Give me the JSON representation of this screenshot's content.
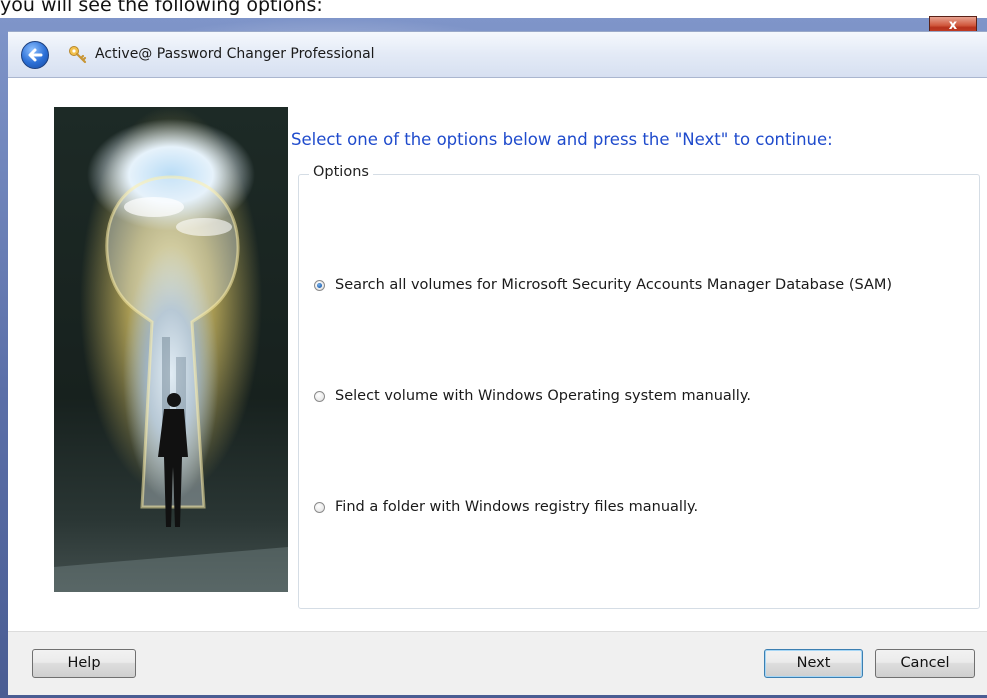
{
  "doc_caption": "you will see the following options:",
  "window": {
    "close_label": "x",
    "title": "Active@ Password Changer Professional"
  },
  "icons": {
    "back": "back-arrow-icon",
    "app": "key-icon",
    "close": "close-icon"
  },
  "main": {
    "instruction": "Select one of the options below and press the \"Next\" to continue:",
    "group_label": "Options",
    "options": [
      {
        "label": "Search all volumes for Microsoft Security Accounts Manager Database (SAM)",
        "selected": true
      },
      {
        "label": "Select volume with Windows Operating system manually.",
        "selected": false
      },
      {
        "label": "Find a folder with Windows registry files manually.",
        "selected": false
      }
    ]
  },
  "footer": {
    "help_label": "Help",
    "next_label": "Next",
    "cancel_label": "Cancel"
  },
  "colors": {
    "instruction_text": "#1f4bcc",
    "window_frame": "#5b6fa8",
    "close_button": "#c9462c"
  }
}
